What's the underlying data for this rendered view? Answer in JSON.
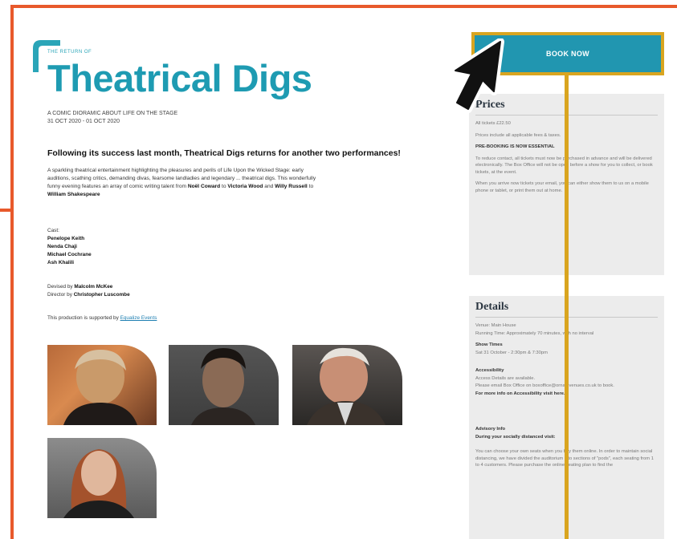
{
  "header": {
    "kicker": "THE RETURN OF",
    "title": "Theatrical Digs",
    "subtitle_line1": "A COMIC DIORAMIC ABOUT LIFE ON THE STAGE",
    "subtitle_line2": "31 OCT 2020 - 01 OCT 2020"
  },
  "content": {
    "lead": "Following its success last month, Theatrical Digs returns for another two performances!",
    "body_line1": "A sparkling theatrical entertainment highlighting the pleasures and perils of Life Upon the Wicked Stage: early",
    "body_line2": "auditions, scathing critics, demanding divas, fearsome landladies and legendary ... theatrical digs. This wonderfully",
    "body_line3_pre": "funny evening features an array of comic writing talent from",
    "body_name1": "Noël Coward",
    "body_to": "to",
    "body_name2": "Victoria Wood",
    "body_and": "and",
    "body_name3": "Willy Russell",
    "body_to2": "to",
    "body_name4": "William Shakespeare",
    "cast_label": "Cast:",
    "cast": [
      "Penelope Keith",
      "Nenda Chaji",
      "Michael Cochrane",
      "Ash Khalili"
    ],
    "devised_label": "Devised by",
    "devised_name": "Malcolm McKee",
    "director_label": "Director by",
    "director_name": "Christopher Luscombe",
    "support_text": "This production is supported by",
    "support_link": "Equalize Events"
  },
  "sidebar": {
    "book_label": "BOOK NOW",
    "prices": {
      "title": "Prices",
      "p1": "All tickets £22.50",
      "p2": "Prices include all applicable fees & taxes.",
      "p3": "PRE-BOOKING IS NOW ESSENTIAL",
      "p4": "To reduce contact, all tickets must now be purchased in advance and will be delivered electronically. The Box Office will not be open before a show for you to collect, or book tickets, at the event.",
      "p5": "When you arrive now tickets your email, you can either show them to us on a mobile phone or tablet, or print them out at home."
    },
    "details": {
      "title": "Details",
      "venue": "Venue: Main House",
      "running": "Running Time: Approximately 70 minutes, with no interval",
      "showtimes_head": "Show Times",
      "showtimes": "Sat 31 October - 2:30pm & 7:30pm",
      "access_head": "Accessibility",
      "access1": "Access Details are available.",
      "access2": "Please email Box Office on boxoffice@ornatevenues.co.uk to book.",
      "access3": "For more info on Accessibility visit here.",
      "advisory_head": "Advisory Info",
      "advisory_bold": "During your socially distanced visit:",
      "advisory_text": "You can choose your own seats when you buy them online. In order to maintain social distancing, we have divided the auditorium into sections of \"pods\", each seating from 1 to 4 customers. Please purchase the online seating plan to find the"
    }
  },
  "colors": {
    "accent_teal": "#1e9bb2",
    "frame_orange": "#e8592b",
    "highlight_yellow": "#d9a520"
  }
}
